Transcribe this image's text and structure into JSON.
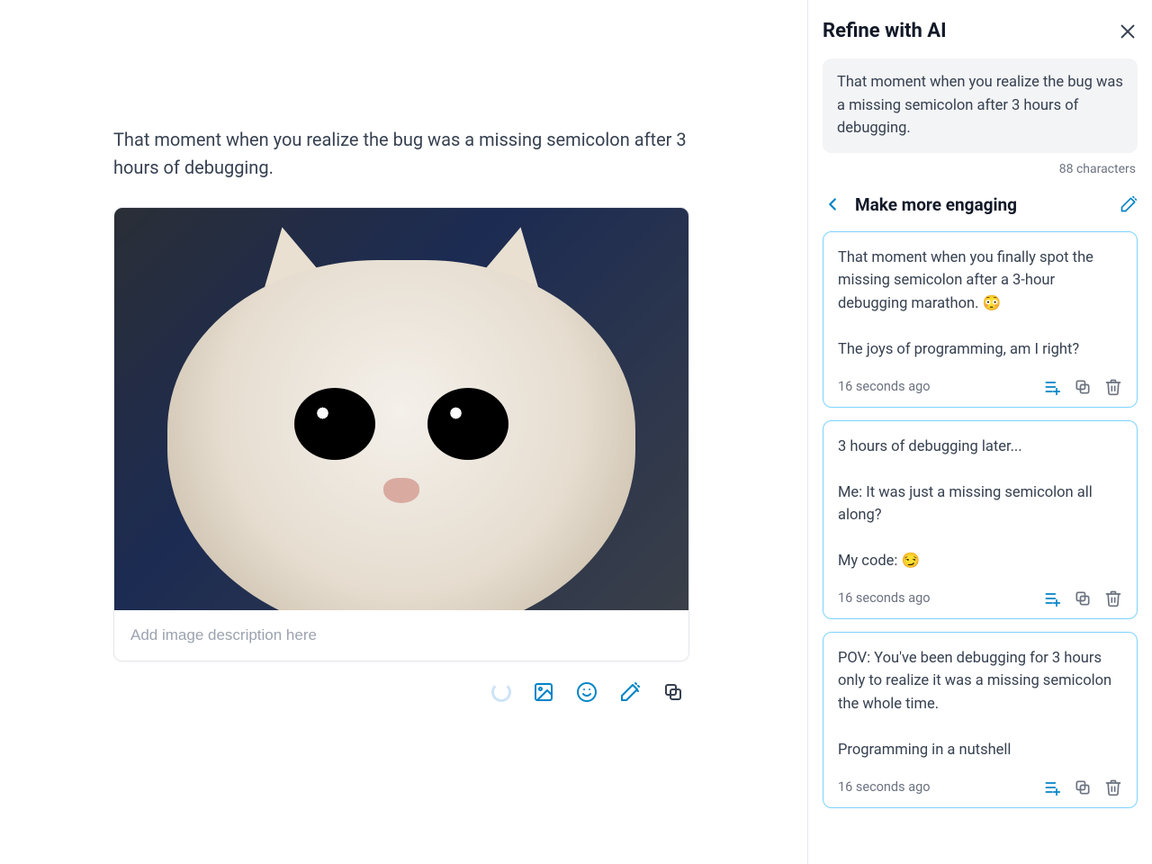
{
  "main": {
    "post_text": "That moment when you realize the bug was a missing semicolon after 3 hours of debugging.",
    "image_desc_placeholder": "Add image description here"
  },
  "sidebar": {
    "title": "Refine with AI",
    "original_text": "That moment when you realize the bug was a missing semicolon after 3 hours of debugging.",
    "char_count": "88 characters",
    "action_title": "Make more engaging",
    "suggestions": [
      {
        "text": "That moment when you finally spot the missing semicolon after a 3-hour debugging marathon. 😳\n\nThe joys of programming, am I right?",
        "time": "16 seconds ago"
      },
      {
        "text": "3 hours of debugging later...\n\nMe: It was just a missing semicolon all along?\n\nMy code: 😏",
        "time": "16 seconds ago"
      },
      {
        "text": "POV: You've been debugging for 3 hours only to realize it was a missing semicolon the whole time.\n\nProgramming in a nutshell",
        "time": "16 seconds ago"
      }
    ]
  }
}
